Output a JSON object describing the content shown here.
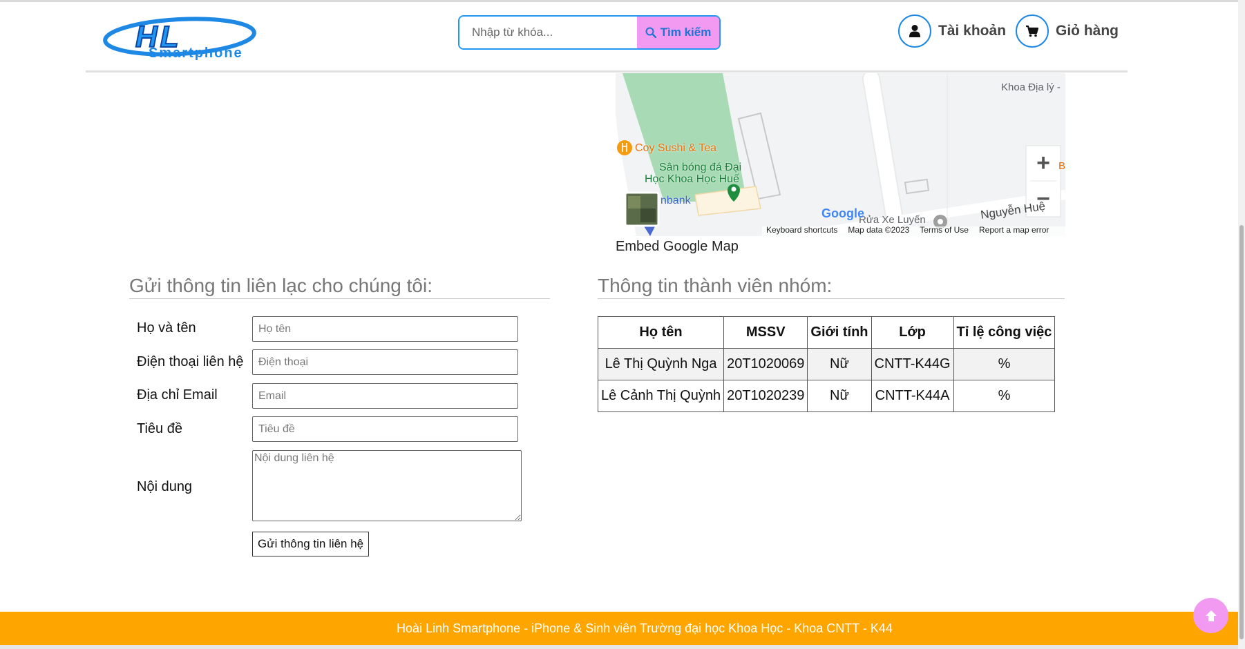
{
  "header": {
    "logo": {
      "text_top": "HL",
      "text_bottom": "Smartphone"
    },
    "search": {
      "placeholder": "Nhập từ khóa...",
      "button_label": "Tìm kiếm"
    },
    "account_label": "Tài khoản",
    "cart_label": "Giỏ hàng"
  },
  "map": {
    "labels": {
      "khoa_dia_ly": "Khoa Địa lý -",
      "coy_sushi": "Coy Sushi & Tea",
      "san_bong_1": "Sân bóng đá Đại",
      "san_bong_2": "Học Khoa Học Huế",
      "nbank": "nbank",
      "rua_xe": "Rửa Xe Luyến",
      "nguyen_hue": "Nguyễn Huệ",
      "edge_b": "B"
    },
    "google": "Google",
    "footer_links": [
      "Keyboard shortcuts",
      "Map data ©2023",
      "Terms of Use",
      "Report a map error"
    ],
    "zoom_in": "+",
    "zoom_out": "−",
    "caption": "Embed Google Map"
  },
  "contact": {
    "title": "Gửi thông tin liên lạc cho chúng tôi:",
    "fields": [
      {
        "label": "Họ và tên",
        "placeholder": "Họ tên",
        "value": ""
      },
      {
        "label": "Điện thoại liên hệ",
        "placeholder": "Điện thoại",
        "value": ""
      },
      {
        "label": "Địa chỉ Email",
        "placeholder": "Email",
        "value": ""
      },
      {
        "label": "Tiêu đề",
        "placeholder": "Tiêu đề",
        "value": ""
      }
    ],
    "message": {
      "label": "Nội dung",
      "placeholder": "Nội dung liên hệ",
      "value": ""
    },
    "submit_label": "Gửi thông tin liên hệ"
  },
  "members": {
    "title": "Thông tin thành viên nhóm:",
    "headers": [
      "Họ tên",
      "MSSV",
      "Giới tính",
      "Lớp",
      "Tỉ lệ công việc"
    ],
    "rows": [
      [
        "Lê Thị Quỳnh Nga",
        "20T1020069",
        "Nữ",
        "CNTT-K44G",
        "%"
      ],
      [
        "Lê Cảnh Thị Quỳnh",
        "20T1020239",
        "Nữ",
        "CNTT-K44A",
        "%"
      ]
    ]
  },
  "footer": {
    "text": "Hoài Linh Smartphone - iPhone & Sinh viên Trường đại học Khoa Học - Khoa CNTT - K44"
  },
  "colors": {
    "accent_blue": "#1e88e5",
    "search_button": "#f29af2",
    "footer": "#ffa500",
    "map_park": "#a8dab5"
  },
  "icons": {
    "search": "search-icon",
    "account": "user-icon",
    "cart": "cart-icon",
    "scroll_top": "arrow-up-icon"
  }
}
